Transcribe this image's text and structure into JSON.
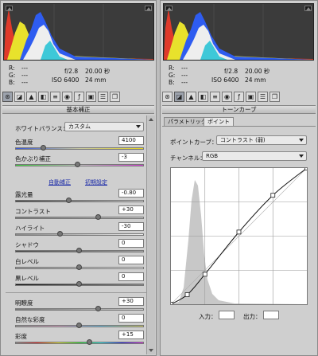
{
  "left": {
    "readout": {
      "r_label": "R:",
      "r_value": "---",
      "g_label": "G:",
      "g_value": "---",
      "b_label": "B:",
      "b_value": "---",
      "aperture": "f/2.8",
      "shutter": "20.00 秒",
      "iso": "ISO 6400",
      "focal": "24 mm"
    },
    "panel_title": "基本補正",
    "white_balance": {
      "label": "ホワイトバランス：",
      "value": "カスタム"
    },
    "temperature": {
      "label": "色温度",
      "value": "4100",
      "position": 0.22
    },
    "tint": {
      "label": "色かぶり補正",
      "value": "-3",
      "position": 0.49
    },
    "links": {
      "auto": "自動補正",
      "default": "初期設定"
    },
    "exposure": {
      "label": "露光量",
      "value": "-0.80",
      "position": 0.42
    },
    "contrast": {
      "label": "コントラスト",
      "value": "+30",
      "position": 0.65
    },
    "highlights": {
      "label": "ハイライト",
      "value": "-30",
      "position": 0.35
    },
    "shadows": {
      "label": "シャドウ",
      "value": "0",
      "position": 0.5
    },
    "whites": {
      "label": "白レベル",
      "value": "0",
      "position": 0.5
    },
    "blacks": {
      "label": "黒レベル",
      "value": "0",
      "position": 0.5
    },
    "clarity": {
      "label": "明瞭度",
      "value": "+30",
      "position": 0.65
    },
    "vibrance": {
      "label": "自然な彩度",
      "value": "0",
      "position": 0.5
    },
    "saturation": {
      "label": "彩度",
      "value": "+15",
      "position": 0.58
    }
  },
  "right": {
    "readout": {
      "r_label": "R:",
      "r_value": "---",
      "g_label": "G:",
      "g_value": "---",
      "b_label": "B:",
      "b_value": "---",
      "aperture": "f/2.8",
      "shutter": "20.00 秒",
      "iso": "ISO 6400",
      "focal": "24 mm"
    },
    "panel_title": "トーンカーブ",
    "tabs": [
      "パラメトリック",
      "ポイント"
    ],
    "active_tab": "ポイント",
    "point_curve": {
      "label": "ポイントカーブ：",
      "value": "コントラスト (弱)"
    },
    "channel": {
      "label": "チャンネル：",
      "value": "RGB"
    },
    "input_label": "入力：",
    "input_value": "",
    "output_label": "出力：",
    "output_value": "",
    "curve_points": [
      [
        0,
        0
      ],
      [
        0.12,
        0.07
      ],
      [
        0.25,
        0.22
      ],
      [
        0.5,
        0.53
      ],
      [
        0.75,
        0.8
      ],
      [
        1,
        1
      ]
    ]
  },
  "toolbar_icons": [
    "aperture-icon",
    "tone-curve-icon",
    "mountain-icon",
    "gradient-icon",
    "sliders-icon",
    "lens-icon",
    "fx-icon",
    "camera-icon",
    "presets-icon",
    "snapshots-icon"
  ]
}
